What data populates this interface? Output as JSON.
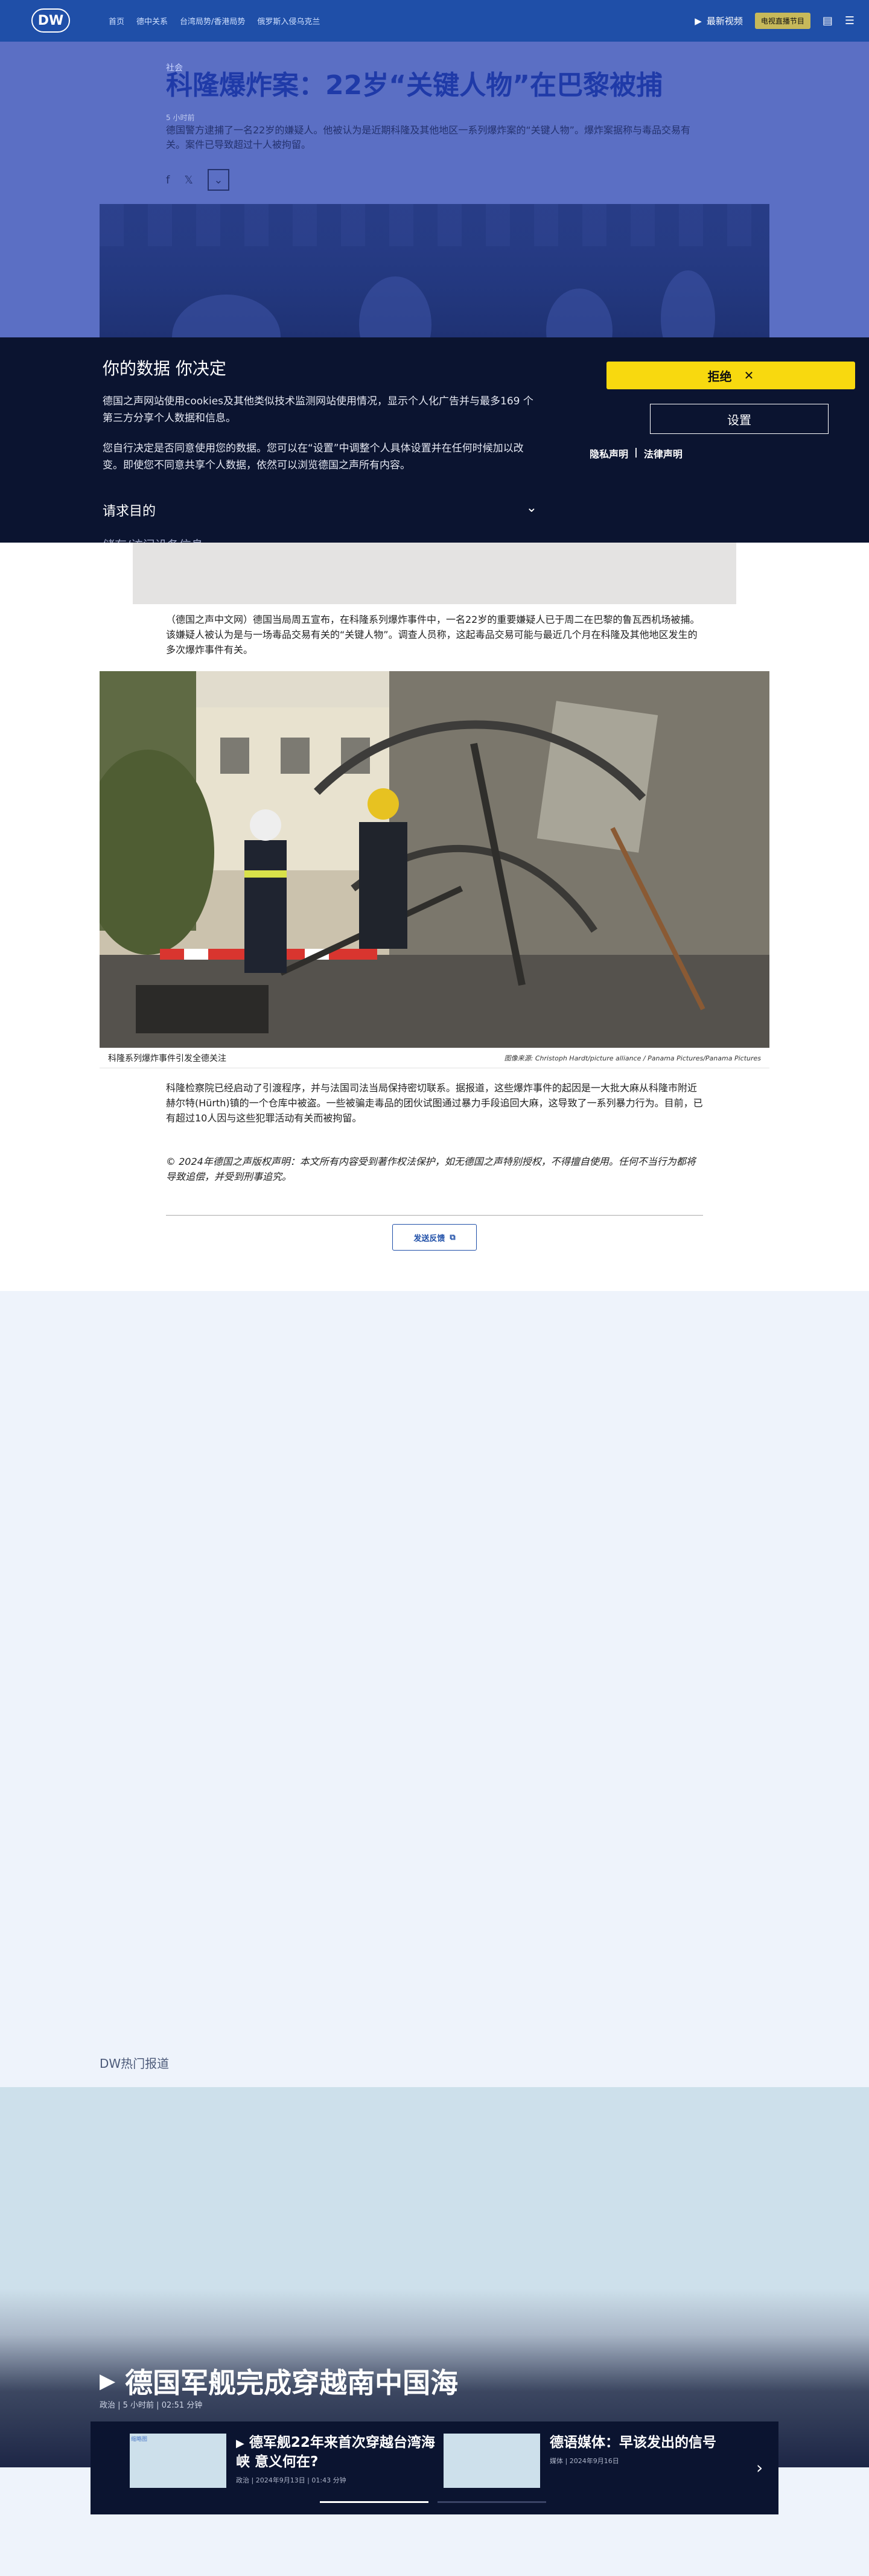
{
  "header": {
    "logo": "DW",
    "nav": [
      "首页",
      "德中关系",
      "台湾局势/香港局势",
      "俄罗斯入侵乌克兰"
    ],
    "live_label": "最新视频",
    "radio_label": "电视直播节目"
  },
  "article": {
    "kicker": "社会",
    "time_ago": "5 小时前",
    "title": "科隆爆炸案：22岁“关键人物”在巴黎被捕",
    "lead": "德国警方逮捕了一名22岁的嫌疑人。他被认为是近期科隆及其他地区一系列爆炸案的“关键人物”。爆炸案据称与毒品交易有关。案件已导致超过十人被拘留。",
    "paragraph1": "（德国之声中文网）德国当局周五宣布，在科隆系列爆炸事件中，一名22岁的重要嫌疑人已于周二在巴黎的鲁瓦西机场被捕。该嫌疑人被认为是与一场毒品交易有关的“关键人物”。调查人员称，这起毒品交易可能与最近几个月在科隆及其他地区发生的多次爆炸事件有关。",
    "caption": "科隆系列爆炸事件引发全德关注",
    "credit": "图像来源: Christoph Hardt/picture alliance / Panama Pictures/Panama Pictures",
    "paragraph2": "科隆检察院已经启动了引渡程序，并与法国司法当局保持密切联系。据报道，这些爆炸事件的起因是一大批大麻从科隆市附近赫尔特(Hürth)镇的一个仓库中被盗。一些被骗走毒品的团伙试图通过暴力手段追回大麻，这导致了一系列暴力行为。目前，已有超过10人因与这些犯罪活动有关而被拘留。",
    "copyright": "© 2024年德国之声版权声明：本文所有内容受到著作权法保护，如无德国之声特别授权，不得擅自使用。任何不当行为都将导致追偿，并受到刑事追究。",
    "feedback_label": "发送反馈"
  },
  "consent": {
    "title": "你的数据 你决定",
    "p1": "德国之声网站使用cookies及其他类似技术监测网站使用情况，显示个人化广告并与最多169 个第三方分享个人数据和信息。",
    "p2": "您自行决定是否同意使用您的数据。您可以在“设置”中调整个人具体设置并在任何时候加以改变。即使您不同意共享个人数据，依然可以浏览德国之声所有内容。",
    "reject_label": "拒绝",
    "settings_label": "设置",
    "privacy_link": "隐私声明",
    "legal_link": "法律声明",
    "purpose_label": "请求目的",
    "cut_text": "储存/访问设备信息"
  },
  "hot": {
    "label": "DW热门报道",
    "feature_title": "德国军舰完成穿越南中国海",
    "feature_meta": "政治 | 5 小时前 | 02:51 分钟",
    "cards": [
      {
        "title": "德军舰22年来首次穿越台湾海峡 意义何在?",
        "meta": "政治 | 2024年9月13日 | 01:43 分钟",
        "thumb_alt": "缩略图"
      },
      {
        "title": "德语媒体：早该发出的信号",
        "meta": "媒体 | 2024年9月16日"
      }
    ]
  },
  "colors": {
    "header_bg": "#1f4fa8",
    "consent_bg": "#0b1430",
    "reject_bg": "#f8d90f"
  }
}
